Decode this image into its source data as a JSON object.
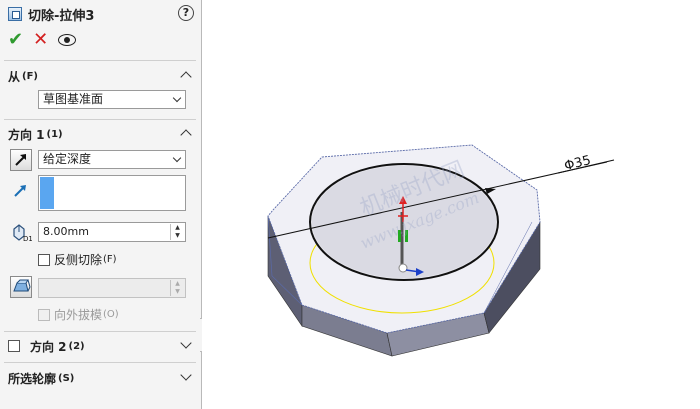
{
  "feature": {
    "title": "切除-拉伸3",
    "help": "?"
  },
  "from_section": {
    "label": "从",
    "shortcut": "(F)",
    "selected": "草图基准面"
  },
  "direction1": {
    "label": "方向 1",
    "shortcut": "(1)",
    "end_condition": "给定深度",
    "depth_value": "8.00mm",
    "flip_side_label": "反侧切除",
    "flip_side_shortcut": "(F)",
    "draft_value": "",
    "draft_outward_label": "向外拔模",
    "draft_outward_shortcut": "(O)"
  },
  "direction2": {
    "label": "方向 2",
    "shortcut": "(2)"
  },
  "selected_contours": {
    "label": "所选轮廓",
    "shortcut": "(S)"
  },
  "viewport": {
    "dimension_label": "Φ35",
    "watermark_cn": "机械时代网",
    "watermark_url": "www.jxage.com"
  }
}
